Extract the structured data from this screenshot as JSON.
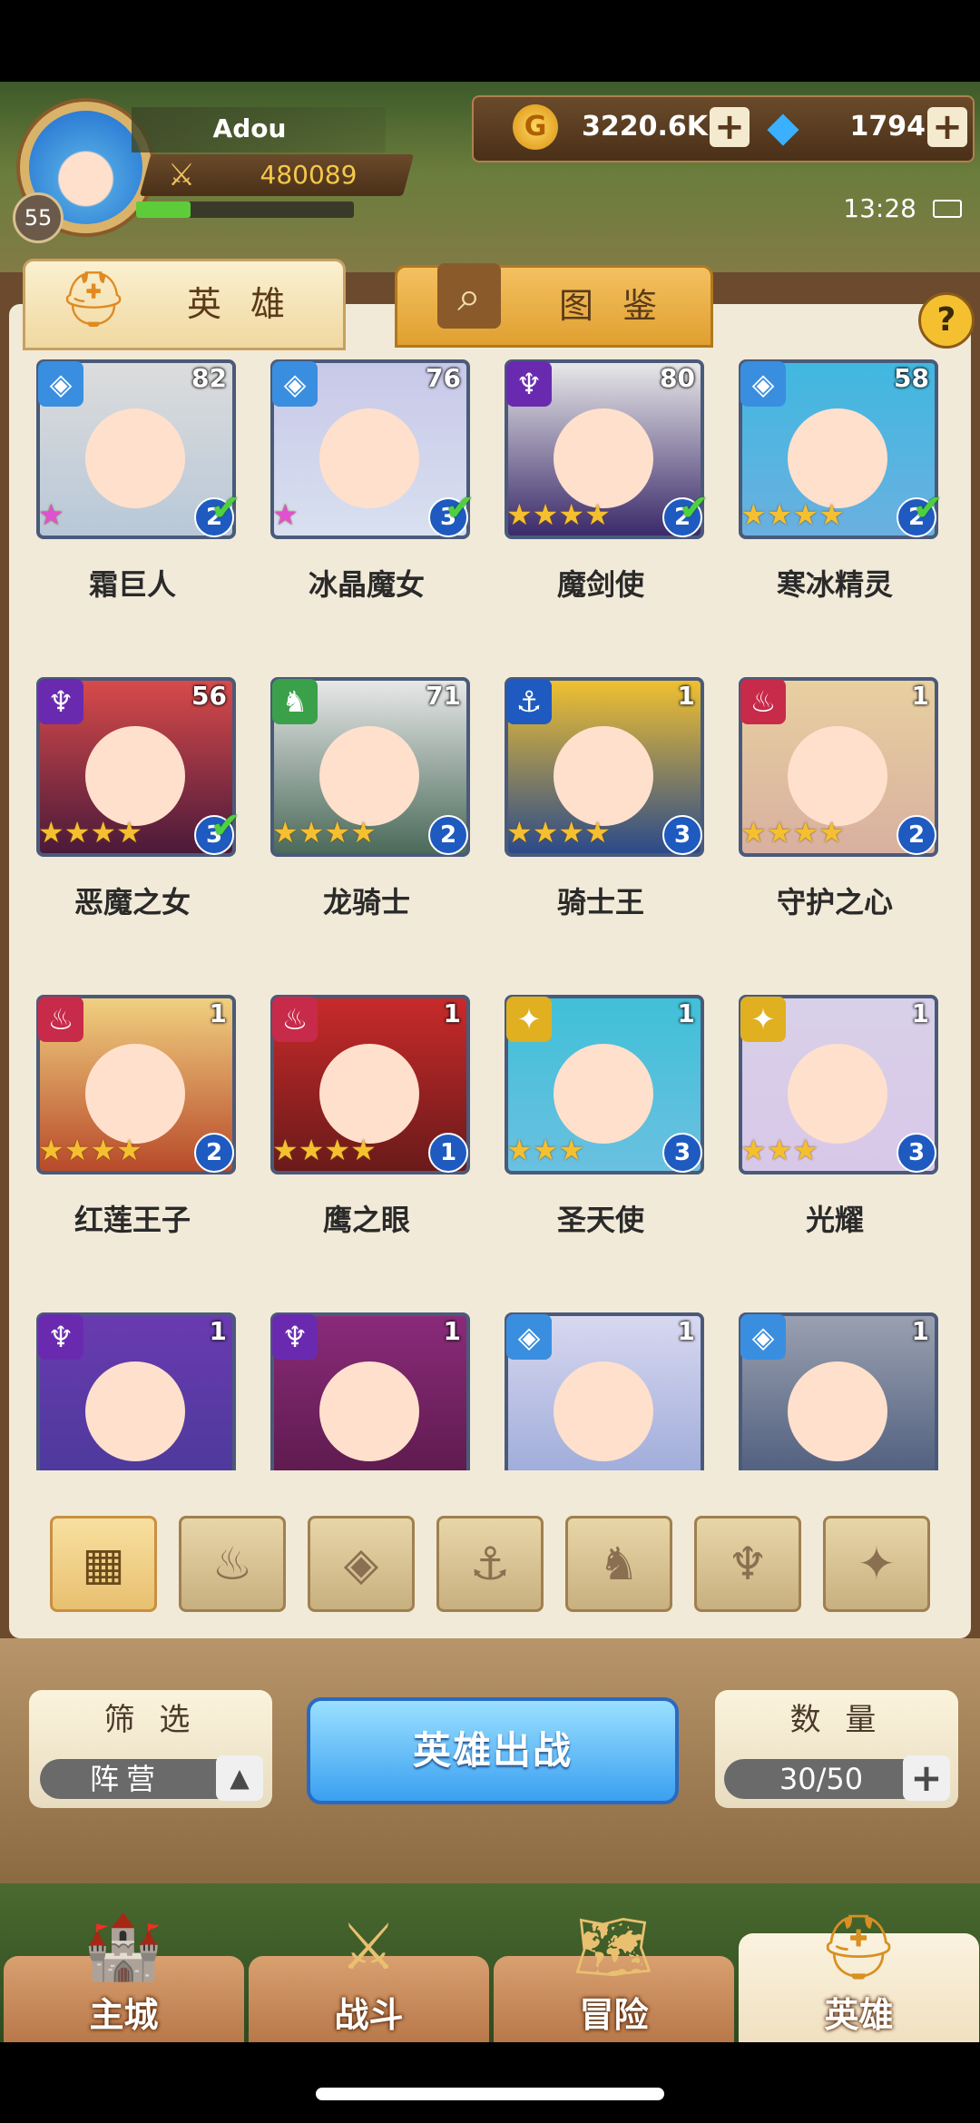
{
  "profile": {
    "name": "Adou",
    "level": "55",
    "power": "480089",
    "exp_fraction": 0.25
  },
  "currency": {
    "gold": "3220.6K",
    "gems": "1794"
  },
  "status": {
    "time": "13:28"
  },
  "tabs": {
    "hero": "英 雄",
    "codex": "图 鉴"
  },
  "heroes": [
    {
      "name": "霜巨人",
      "level": "82",
      "stars": "★",
      "grade": "2",
      "faction": "ice",
      "checked": true,
      "rainbow": true
    },
    {
      "name": "冰晶魔女",
      "level": "76",
      "stars": "★",
      "grade": "3",
      "faction": "ice",
      "checked": true,
      "rainbow": true
    },
    {
      "name": "魔剑使",
      "level": "80",
      "stars": "★★★★",
      "grade": "2",
      "faction": "dark",
      "checked": true,
      "rainbow": false
    },
    {
      "name": "寒冰精灵",
      "level": "58",
      "stars": "★★★★",
      "grade": "2",
      "faction": "ice",
      "checked": true,
      "rainbow": false
    },
    {
      "name": "恶魔之女",
      "level": "56",
      "stars": "★★★★",
      "grade": "3",
      "faction": "dark",
      "checked": true,
      "rainbow": false
    },
    {
      "name": "龙骑士",
      "level": "71",
      "stars": "★★★★",
      "grade": "2",
      "faction": "beast",
      "checked": false,
      "rainbow": false
    },
    {
      "name": "骑士王",
      "level": "1",
      "stars": "★★★★",
      "grade": "3",
      "faction": "sea",
      "checked": false,
      "rainbow": false
    },
    {
      "name": "守护之心",
      "level": "1",
      "stars": "★★★★",
      "grade": "2",
      "faction": "fire",
      "checked": false,
      "rainbow": false
    },
    {
      "name": "红莲王子",
      "level": "1",
      "stars": "★★★★",
      "grade": "2",
      "faction": "fire",
      "checked": false,
      "rainbow": false
    },
    {
      "name": "鹰之眼",
      "level": "1",
      "stars": "★★★★",
      "grade": "1",
      "faction": "fire",
      "checked": false,
      "rainbow": false
    },
    {
      "name": "圣天使",
      "level": "1",
      "stars": "★★★",
      "grade": "3",
      "faction": "light",
      "checked": false,
      "rainbow": false
    },
    {
      "name": "光耀",
      "level": "1",
      "stars": "★★★",
      "grade": "3",
      "faction": "light",
      "checked": false,
      "rainbow": false
    },
    {
      "name": "",
      "level": "1",
      "stars": "",
      "grade": "",
      "faction": "dark",
      "checked": false,
      "rainbow": false
    },
    {
      "name": "",
      "level": "1",
      "stars": "",
      "grade": "",
      "faction": "dark",
      "checked": false,
      "rainbow": false
    },
    {
      "name": "",
      "level": "1",
      "stars": "",
      "grade": "",
      "faction": "ice",
      "checked": false,
      "rainbow": false
    },
    {
      "name": "",
      "level": "1",
      "stars": "",
      "grade": "",
      "faction": "ice",
      "checked": false,
      "rainbow": false
    }
  ],
  "faction_colors": {
    "ice": "#3a8ee0",
    "dark": "#6a2ab0",
    "beast": "#3aa04a",
    "sea": "#1e5ac0",
    "fire": "#c82a4a",
    "light": "#e0b020"
  },
  "faction_icons": {
    "ice": "◈",
    "dark": "♆",
    "beast": "♞",
    "sea": "⚓",
    "fire": "♨",
    "light": "✦"
  },
  "filters": [
    {
      "icon": "grid-icon",
      "glyph": "▦",
      "active": true
    },
    {
      "icon": "fire-faction-icon",
      "glyph": "♨",
      "active": false
    },
    {
      "icon": "ice-faction-icon",
      "glyph": "◈",
      "active": false
    },
    {
      "icon": "sea-faction-icon",
      "glyph": "⚓",
      "active": false
    },
    {
      "icon": "beast-faction-icon",
      "glyph": "♞",
      "active": false
    },
    {
      "icon": "dark-faction-icon",
      "glyph": "♆",
      "active": false
    },
    {
      "icon": "light-faction-icon",
      "glyph": "✦",
      "active": false
    }
  ],
  "controls": {
    "filter_title": "筛 选",
    "filter_value": "阵营",
    "deploy": "英雄出战",
    "count_title": "数 量",
    "count_value": "30/50"
  },
  "nav": [
    {
      "label": "主城",
      "icon": "castle-icon",
      "glyph": "🏰",
      "active": false
    },
    {
      "label": "战斗",
      "icon": "crossed-swords-icon",
      "glyph": "⚔",
      "active": false
    },
    {
      "label": "冒险",
      "icon": "scroll-map-icon",
      "glyph": "🗺",
      "active": false
    },
    {
      "label": "英雄",
      "icon": "hero-helmet-icon",
      "glyph": "⛑",
      "active": true
    }
  ]
}
